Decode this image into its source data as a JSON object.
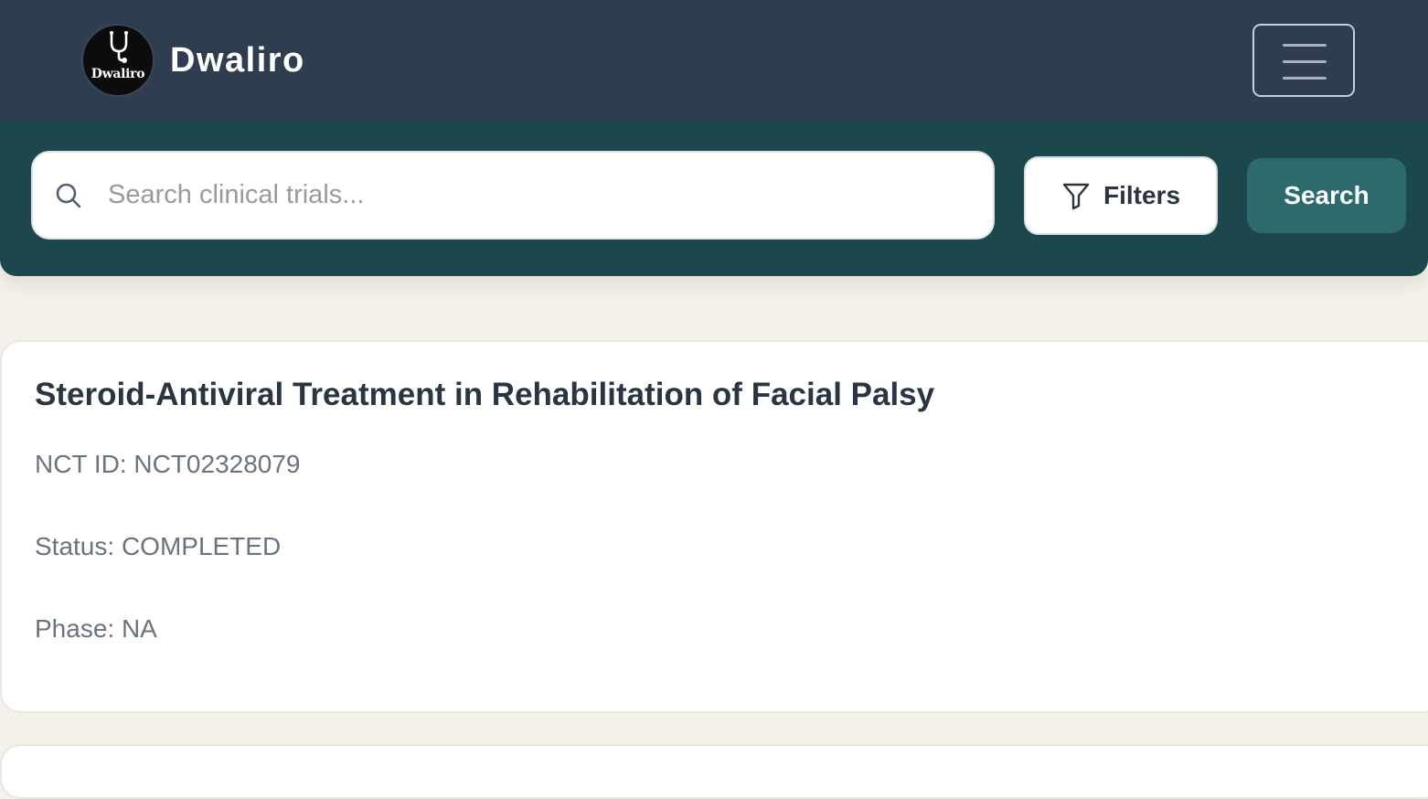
{
  "header": {
    "brand_name": "Dwaliro",
    "logo_text": "Dwaliro",
    "background_color": "#2e3d50"
  },
  "search": {
    "placeholder": "Search clinical trials...",
    "value": "",
    "filters_label": "Filters",
    "search_label": "Search",
    "panel_color": "#1c474d",
    "search_button_color": "#2c6a6e"
  },
  "results": [
    {
      "title": "Steroid-Antiviral Treatment in Rehabilitation of Facial Palsy",
      "nct_id": "NCT ID: NCT02328079",
      "status": "Status: COMPLETED",
      "phase": "Phase: NA"
    }
  ],
  "icons": {
    "logo": "stethoscope-icon",
    "menu": "hamburger-menu-icon",
    "search": "search-icon",
    "filters": "filter-funnel-icon"
  }
}
